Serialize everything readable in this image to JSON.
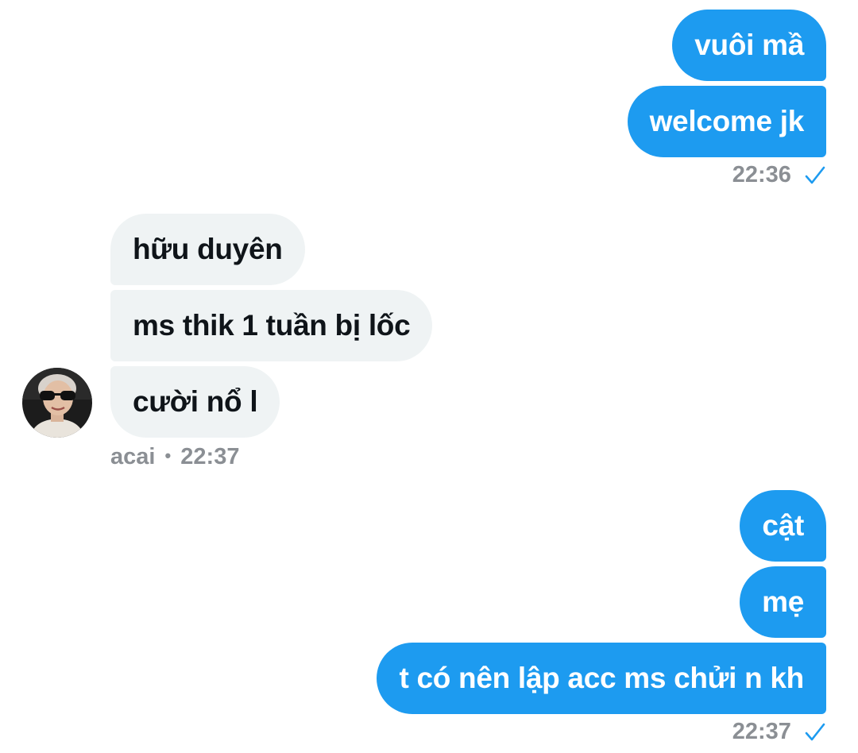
{
  "conversation": {
    "group1": {
      "messages": [
        "vuôi mầ",
        "welcome jk"
      ],
      "time": "22:36"
    },
    "group2": {
      "messages": [
        "hữu duyên",
        "ms thik 1 tuần bị lốc",
        "cười nổ l"
      ],
      "sender": "acai",
      "separator": "•",
      "time": "22:37"
    },
    "group3": {
      "messages": [
        "cật",
        "mẹ",
        "t có nên lập acc ms chửi n kh"
      ],
      "time": "22:37"
    }
  },
  "colors": {
    "outgoing_bubble": "#1d9bf0",
    "incoming_bubble": "#eff3f4",
    "meta_text": "#8b8f94",
    "read_check": "#1d9bf0"
  },
  "icons": {
    "read_receipt": "check-icon",
    "avatar": "user-avatar"
  }
}
